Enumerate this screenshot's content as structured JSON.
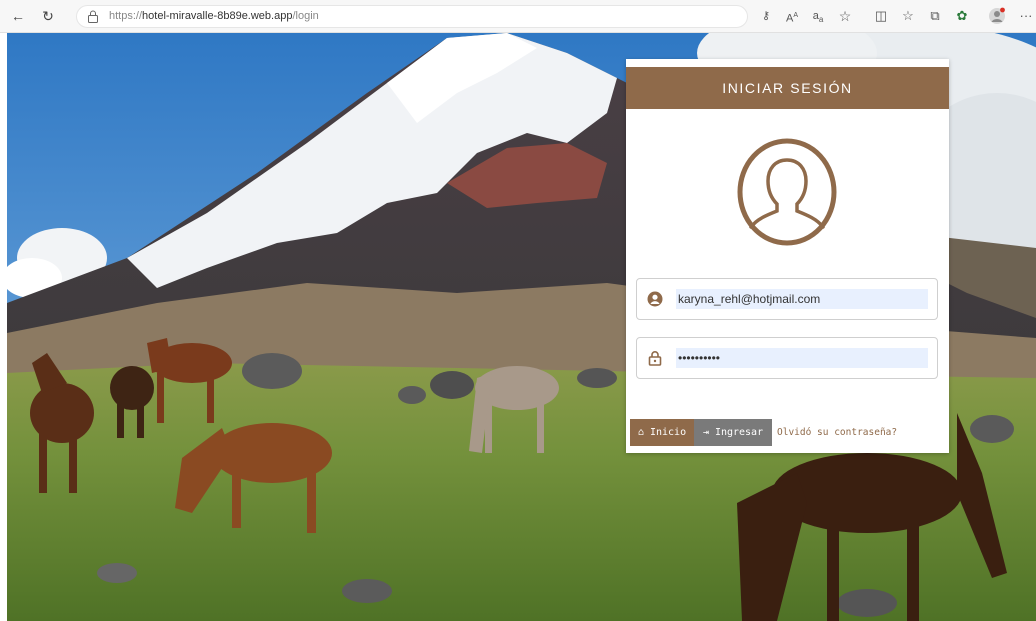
{
  "browser": {
    "url_scheme": "https://",
    "url_host": "hotel-miravalle-8b89e.web.app",
    "url_path": "/login",
    "icons": [
      "back-icon",
      "refresh-icon",
      "lock-icon",
      "key-icon",
      "read-aloud-icon",
      "immersive-reader-icon",
      "favorite-icon",
      "split-screen-icon",
      "favorites-bar-icon",
      "collections-icon",
      "copilot-icon",
      "profile-icon",
      "more-icon"
    ]
  },
  "login": {
    "title": "INICIAR SESIÓN",
    "email_value": "karyna_rehl@hotjmail.com",
    "password_value": "••••••••••",
    "home_button": "Inicio",
    "login_button": "Ingresar",
    "forgot_link": "Olvidó su contraseña?"
  },
  "colors": {
    "brand_brown": "#8f6a4a",
    "button_gray": "#7a7a7a",
    "autofill_blue": "#e8f0fe"
  }
}
